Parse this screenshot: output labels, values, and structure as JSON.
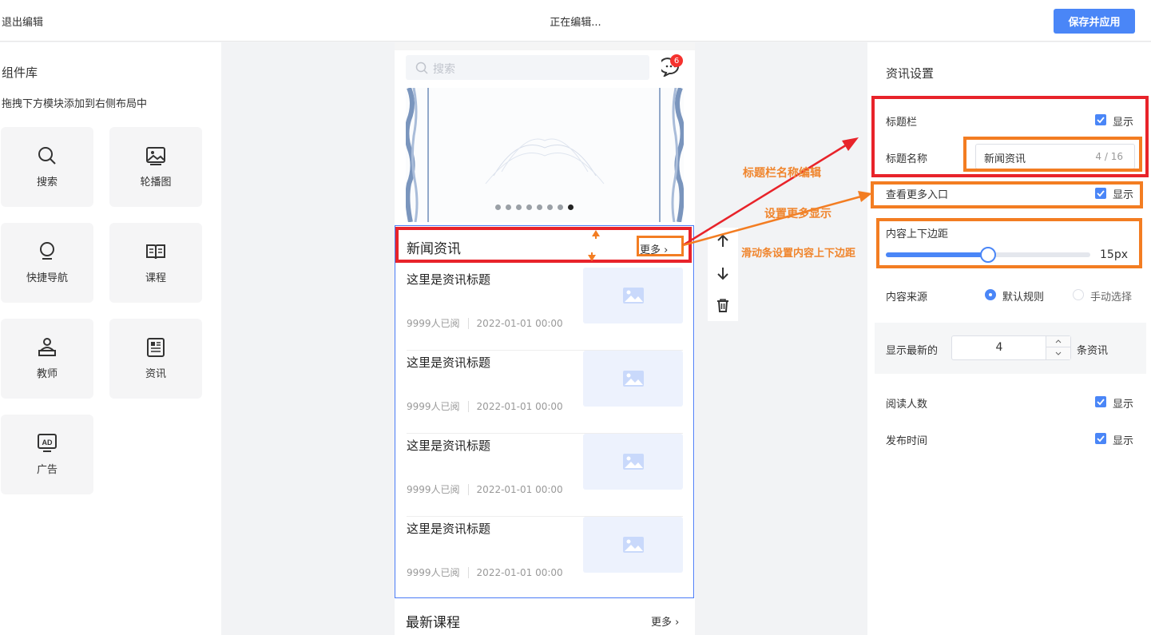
{
  "header": {
    "exit_label": "退出编辑",
    "status": "正在编辑...",
    "save_label": "保存并应用"
  },
  "library": {
    "title": "组件库",
    "hint": "拖拽下方模块添加到右侧布局中",
    "tiles": [
      {
        "label": "搜索",
        "icon": "search-icon"
      },
      {
        "label": "轮播图",
        "icon": "image-icon"
      },
      {
        "label": "快捷导航",
        "icon": "bulb-icon"
      },
      {
        "label": "课程",
        "icon": "book-icon"
      },
      {
        "label": "教师",
        "icon": "teacher-icon"
      },
      {
        "label": "资讯",
        "icon": "newspaper-icon"
      },
      {
        "label": "广告",
        "icon": "ad-icon"
      }
    ]
  },
  "preview": {
    "search_placeholder": "搜索",
    "message_badge": "6",
    "banner_dots": 8,
    "banner_active_dot": 8,
    "news": {
      "title": "新闻资讯",
      "more": "更多",
      "items": [
        {
          "title": "这里是资讯标题",
          "reads": "9999人已阅",
          "date": "2022-01-01 00:00"
        },
        {
          "title": "这里是资讯标题",
          "reads": "9999人已阅",
          "date": "2022-01-01 00:00"
        },
        {
          "title": "这里是资讯标题",
          "reads": "9999人已阅",
          "date": "2022-01-01 00:00"
        },
        {
          "title": "这里是资讯标题",
          "reads": "9999人已阅",
          "date": "2022-01-01 00:00"
        }
      ]
    },
    "course": {
      "title": "最新课程",
      "more": "更多"
    }
  },
  "settings": {
    "title": "资讯设置",
    "title_bar": {
      "label": "标题栏",
      "show": "显示",
      "checked": true
    },
    "title_name": {
      "label": "标题名称",
      "value": "新闻资讯",
      "count": "4 / 16"
    },
    "view_more": {
      "label": "查看更多入口",
      "show": "显示",
      "checked": true
    },
    "padding": {
      "label": "内容上下边距",
      "value": "15px",
      "fraction": 0.5
    },
    "source": {
      "label": "内容来源",
      "options": [
        "默认规则",
        "手动选择"
      ],
      "selected": "默认规则"
    },
    "latest": {
      "label": "显示最新的",
      "value": "4",
      "suffix": "条资讯"
    },
    "read_count": {
      "label": "阅读人数",
      "show": "显示",
      "checked": true
    },
    "publish_time": {
      "label": "发布时间",
      "show": "显示",
      "checked": true
    }
  },
  "annotations": {
    "note_title_edit": "标题栏名称编辑",
    "note_more": "设置更多显示",
    "note_slider": "滑动条设置内容上下边距",
    "colors": {
      "red": "#e8232a",
      "orange": "#f37d22",
      "accent": "#4a86f7"
    }
  }
}
